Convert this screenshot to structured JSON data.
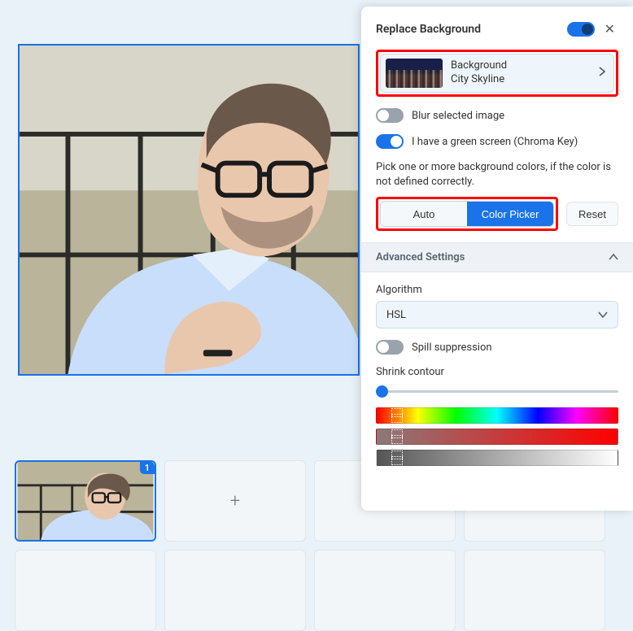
{
  "panel": {
    "title": "Replace Background",
    "feature_enabled": true,
    "bg_card": {
      "label": "Background",
      "name": "City Skyline"
    },
    "blur": {
      "label": "Blur selected image",
      "on": false
    },
    "chroma": {
      "label": "I have a green screen (Chroma Key)",
      "on": true
    },
    "hint": "Pick one or more background colors, if the color is not defined correctly.",
    "seg": {
      "auto": "Auto",
      "picker": "Color Picker",
      "active": "picker"
    },
    "reset": "Reset",
    "advanced": {
      "title": "Advanced Settings",
      "expanded": true
    },
    "algorithm": {
      "label": "Algorithm",
      "value": "HSL"
    },
    "spill": {
      "label": "Spill suppression",
      "on": false
    },
    "shrink": {
      "label": "Shrink contour"
    }
  },
  "thumbs": {
    "badge": "1",
    "plus": "+"
  }
}
